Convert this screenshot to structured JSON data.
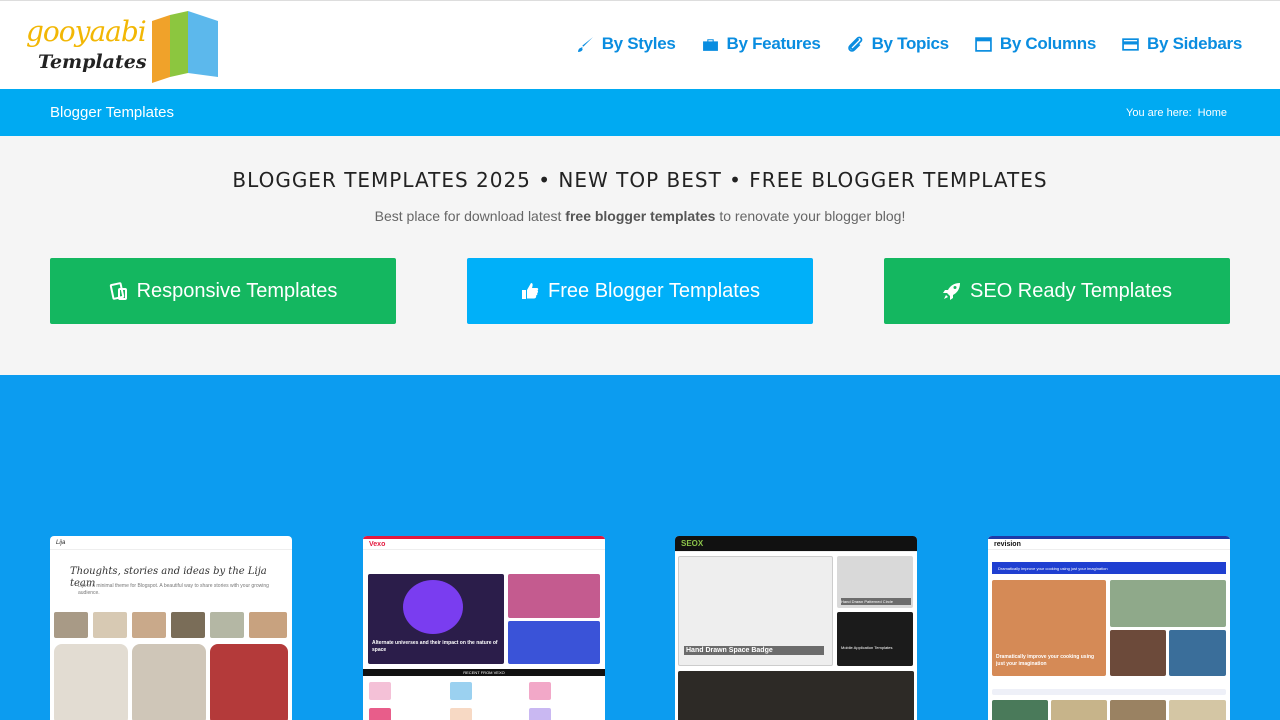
{
  "logo": {
    "line1": "gooyaabi",
    "line2": "Templates"
  },
  "nav": [
    {
      "label": "By Styles",
      "icon": "brush-icon"
    },
    {
      "label": "By Features",
      "icon": "briefcase-icon"
    },
    {
      "label": "By Topics",
      "icon": "paperclip-icon"
    },
    {
      "label": "By Columns",
      "icon": "window-icon"
    },
    {
      "label": "By Sidebars",
      "icon": "card-icon"
    }
  ],
  "titlebar": {
    "title": "Blogger Templates",
    "crumb_prefix": "You are here:",
    "crumb_home": "Home"
  },
  "hero": {
    "heading": "BLOGGER TEMPLATES 2025 • NEW TOP BEST • FREE BLOGGER TEMPLATES",
    "sub_before": "Best place for download latest ",
    "sub_bold": "free blogger templates",
    "sub_after": " to renovate your blogger blog!"
  },
  "cta": [
    {
      "label": "Responsive Templates",
      "icon": "devices-icon",
      "color": "#14b760"
    },
    {
      "label": "Free Blogger Templates",
      "icon": "thumbs-up-icon",
      "color": "#00b0f9"
    },
    {
      "label": "SEO Ready Templates",
      "icon": "rocket-icon",
      "color": "#14b760"
    }
  ],
  "thumbs": [
    {
      "name": "Lija",
      "tagline": "Thoughts, stories and ideas by the Lija team",
      "desc": "Lija is a minimal theme for Blogspot. A beautiful way to share stories with your growing audience."
    },
    {
      "name": "Vexo",
      "headline": "Alternate universes and their impact on the nature of space",
      "section": "RECENT FROM VEXO"
    },
    {
      "name": "SEOX",
      "headline": "Hand Drawn Space Badge",
      "side1": "Hand Drawn Patterned Circle",
      "side2": "Mobile Application Templates"
    },
    {
      "name": "revision",
      "banner": "Dramatically improve your cooking using just your imagination",
      "headline": "Dramatically improve your cooking using just your imagination"
    }
  ]
}
